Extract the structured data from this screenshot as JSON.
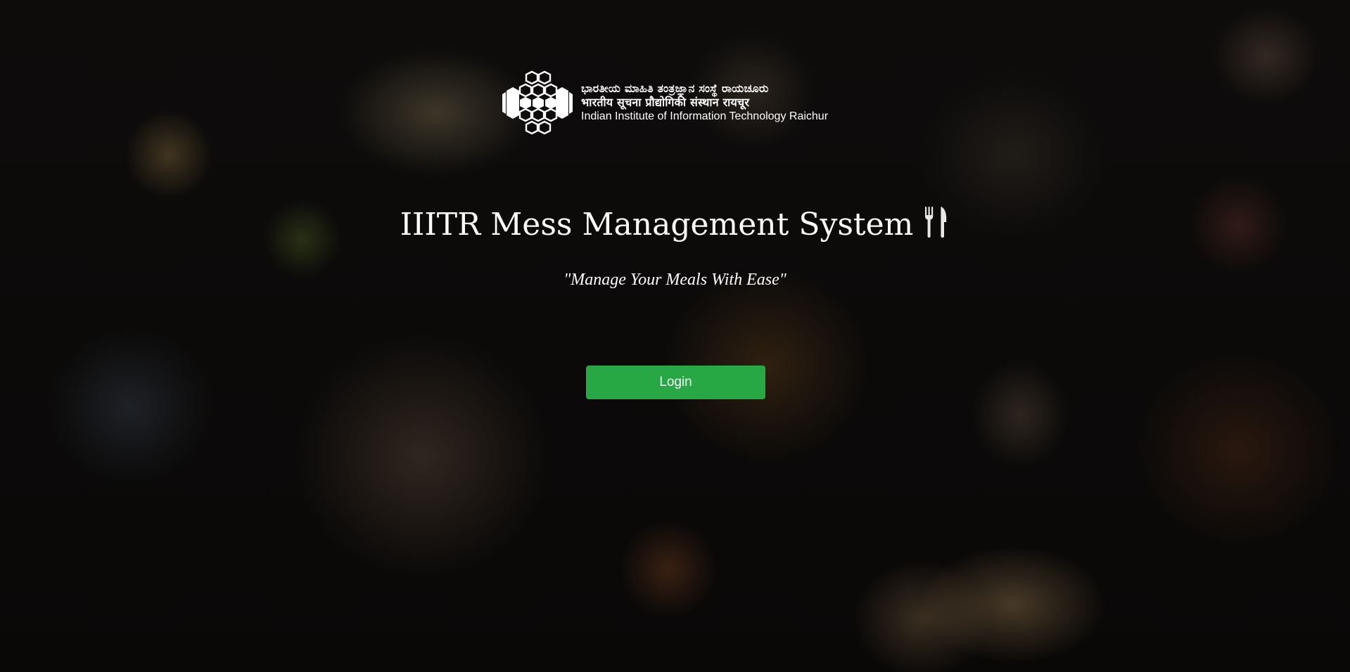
{
  "header": {
    "institute_name_kannada": "ಭಾರತೀಯ ಮಾಹಿತಿ ತಂತ್ರಜ್ಞಾನ ಸಂಸ್ಥೆ ರಾಯಚೂರು",
    "institute_name_hindi": "भारतीय सूचना प्रौद्योगिकी संस्थान रायचूर",
    "institute_name_english": "Indian Institute of Information Technology Raichur",
    "logo_icon": "hexagon-network-logo"
  },
  "hero": {
    "title": "IIITR Mess Management System",
    "title_icon": "fork-knife-icon",
    "tagline": "\"Manage Your Meals With Ease\""
  },
  "actions": {
    "login_label": "Login"
  },
  "colors": {
    "login_button": "#28a745",
    "text": "#ffffff"
  }
}
